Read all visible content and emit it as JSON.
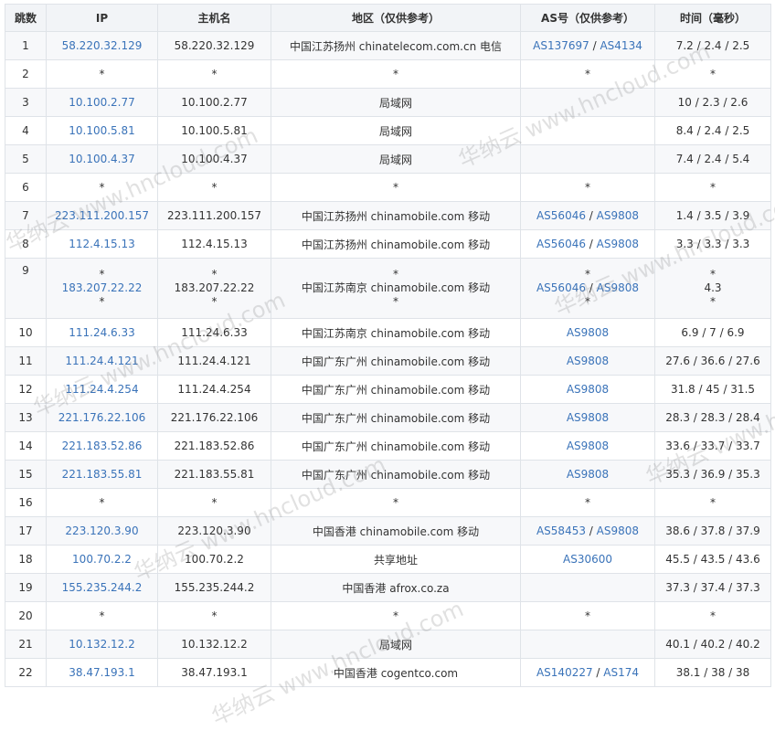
{
  "headers": [
    "跳数",
    "IP",
    "主机名",
    "地区（仅供参考）",
    "AS号（仅供参考）",
    "时间（毫秒）"
  ],
  "watermark": "华纳云 www.hncloud.com",
  "rows": [
    {
      "hop": "1",
      "ip": "58.220.32.129",
      "host": "58.220.32.129",
      "region": "中国江苏扬州 chinatelecom.com.cn 电信",
      "as": [
        "AS137697",
        "AS4134"
      ],
      "time": "7.2 / 2.4 / 2.5"
    },
    {
      "hop": "2",
      "ip": "*",
      "host": "*",
      "region": "*",
      "as": [
        "*"
      ],
      "time": "*"
    },
    {
      "hop": "3",
      "ip": "10.100.2.77",
      "host": "10.100.2.77",
      "region": "局域网",
      "as": [],
      "time": "10 / 2.3 / 2.6"
    },
    {
      "hop": "4",
      "ip": "10.100.5.81",
      "host": "10.100.5.81",
      "region": "局域网",
      "as": [],
      "time": "8.4 / 2.4 / 2.5"
    },
    {
      "hop": "5",
      "ip": "10.100.4.37",
      "host": "10.100.4.37",
      "region": "局域网",
      "as": [],
      "time": "7.4 / 2.4 / 5.4"
    },
    {
      "hop": "6",
      "ip": "*",
      "host": "*",
      "region": "*",
      "as": [
        "*"
      ],
      "time": "*"
    },
    {
      "hop": "7",
      "ip": "223.111.200.157",
      "host": "223.111.200.157",
      "region": "中国江苏扬州 chinamobile.com 移动",
      "as": [
        "AS56046",
        "AS9808"
      ],
      "time": "1.4 / 3.5 / 3.9"
    },
    {
      "hop": "8",
      "ip": "112.4.15.13",
      "host": "112.4.15.13",
      "region": "中国江苏扬州 chinamobile.com 移动",
      "as": [
        "AS56046",
        "AS9808"
      ],
      "time": "3.3 / 3.3 / 3.3"
    },
    {
      "hop": "9",
      "ip": "183.207.22.22",
      "host": "183.207.22.22",
      "region": "中国江苏南京 chinamobile.com 移动",
      "as": [
        "AS56046",
        "AS9808"
      ],
      "time": "4.3",
      "multi": true
    },
    {
      "hop": "10",
      "ip": "111.24.6.33",
      "host": "111.24.6.33",
      "region": "中国江苏南京 chinamobile.com 移动",
      "as": [
        "AS9808"
      ],
      "time": "6.9 / 7 / 6.9"
    },
    {
      "hop": "11",
      "ip": "111.24.4.121",
      "host": "111.24.4.121",
      "region": "中国广东广州 chinamobile.com 移动",
      "as": [
        "AS9808"
      ],
      "time": "27.6 / 36.6 / 27.6"
    },
    {
      "hop": "12",
      "ip": "111.24.4.254",
      "host": "111.24.4.254",
      "region": "中国广东广州 chinamobile.com 移动",
      "as": [
        "AS9808"
      ],
      "time": "31.8 / 45 / 31.5"
    },
    {
      "hop": "13",
      "ip": "221.176.22.106",
      "host": "221.176.22.106",
      "region": "中国广东广州 chinamobile.com 移动",
      "as": [
        "AS9808"
      ],
      "time": "28.3 / 28.3 / 28.4"
    },
    {
      "hop": "14",
      "ip": "221.183.52.86",
      "host": "221.183.52.86",
      "region": "中国广东广州 chinamobile.com 移动",
      "as": [
        "AS9808"
      ],
      "time": "33.6 / 33.7 / 33.7"
    },
    {
      "hop": "15",
      "ip": "221.183.55.81",
      "host": "221.183.55.81",
      "region": "中国广东广州 chinamobile.com 移动",
      "as": [
        "AS9808"
      ],
      "time": "35.3 / 36.9 / 35.3"
    },
    {
      "hop": "16",
      "ip": "*",
      "host": "*",
      "region": "*",
      "as": [
        "*"
      ],
      "time": "*"
    },
    {
      "hop": "17",
      "ip": "223.120.3.90",
      "host": "223.120.3.90",
      "region": "中国香港 chinamobile.com 移动",
      "as": [
        "AS58453",
        "AS9808"
      ],
      "time": "38.6 / 37.8 / 37.9"
    },
    {
      "hop": "18",
      "ip": "100.70.2.2",
      "host": "100.70.2.2",
      "region": "共享地址",
      "as": [
        "AS30600"
      ],
      "time": "45.5 / 43.5 / 43.6"
    },
    {
      "hop": "19",
      "ip": "155.235.244.2",
      "host": "155.235.244.2",
      "region": "中国香港 afrox.co.za",
      "as": [],
      "time": "37.3 / 37.4 / 37.3"
    },
    {
      "hop": "20",
      "ip": "*",
      "host": "*",
      "region": "*",
      "as": [
        "*"
      ],
      "time": "*"
    },
    {
      "hop": "21",
      "ip": "10.132.12.2",
      "host": "10.132.12.2",
      "region": "局域网",
      "as": [],
      "time": "40.1 / 40.2 / 40.2"
    },
    {
      "hop": "22",
      "ip": "38.47.193.1",
      "host": "38.47.193.1",
      "region": "中国香港 cogentco.com",
      "as": [
        "AS140227",
        "AS174"
      ],
      "time": "38.1 / 38 / 38"
    }
  ]
}
